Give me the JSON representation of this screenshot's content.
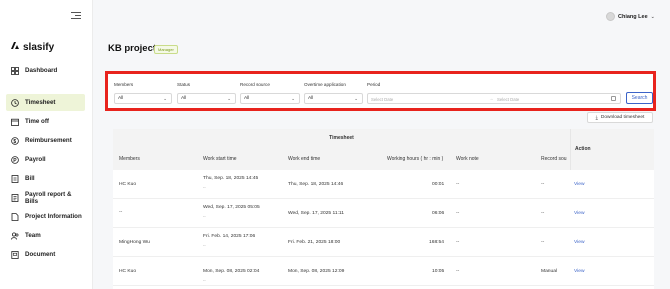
{
  "user": {
    "name": "Chiang Lee"
  },
  "brand": {
    "name": "slasify"
  },
  "sidebar": {
    "items": [
      {
        "label": "Dashboard",
        "icon": "dashboard-icon"
      },
      {
        "label": "Timesheet",
        "icon": "timesheet-icon",
        "active": true
      },
      {
        "label": "Time off",
        "icon": "calendar-icon"
      },
      {
        "label": "Reimbursement",
        "icon": "dollar-icon"
      },
      {
        "label": "Payroll",
        "icon": "payroll-icon"
      },
      {
        "label": "Bill",
        "icon": "bill-icon"
      },
      {
        "label": "Payroll report & Bills",
        "icon": "report-icon"
      },
      {
        "label": "Project Information",
        "icon": "document-icon"
      },
      {
        "label": "Team",
        "icon": "team-icon"
      },
      {
        "label": "Document",
        "icon": "folder-icon"
      }
    ]
  },
  "page": {
    "title": "KB project",
    "badge": "Manager"
  },
  "filters": {
    "members": {
      "label": "Members",
      "value": "All"
    },
    "status": {
      "label": "Status",
      "value": "All"
    },
    "record_source": {
      "label": "Record source",
      "value": "All"
    },
    "overtime": {
      "label": "Overtime application",
      "value": "All"
    },
    "period": {
      "label": "Period",
      "start_placeholder": "Select Date",
      "end_placeholder": "Select Date"
    },
    "search_label": "Search",
    "highlight_color": "#e8231d"
  },
  "download_label": "Download timesheet",
  "table": {
    "group_header": "Timesheet",
    "action_header": "Action",
    "columns": [
      "Members",
      "Work start time",
      "Work end time",
      "Working hours ( hr : min )",
      "Work note",
      "Record sou"
    ],
    "rows": [
      {
        "member": "HC Kuo",
        "start": "Thu, Sep. 18, 2025 14:45",
        "start_sub": "--",
        "end": "Thu, Sep. 18, 2025 14:46",
        "hours": "00:01",
        "note": "--",
        "source": "--",
        "action": "View"
      },
      {
        "member": "--",
        "start": "Wed, Sep. 17, 2025 05:05",
        "start_sub": "--",
        "end": "Wed, Sep. 17, 2025 11:11",
        "hours": "06:06",
        "note": "--",
        "source": "--",
        "action": "View"
      },
      {
        "member": "MingHong Wu",
        "start": "Fri. Feb. 14, 2025 17:06",
        "start_sub": "--",
        "end": "Fri. Feb. 21, 2025 18:00",
        "hours": "168:54",
        "note": "--",
        "source": "--",
        "action": "View"
      },
      {
        "member": "HC Kuo",
        "start": "Mon, Sep. 08, 2025 02:04",
        "start_sub": "--",
        "end": "Mon, Sep. 08, 2025 12:09",
        "hours": "10:05",
        "note": "--",
        "source": "Manual",
        "action": "View"
      }
    ]
  },
  "colors": {
    "accent_blue": "#3b63c8",
    "active_nav": "#eef4d8",
    "badge_green": "#7a9a1a"
  }
}
